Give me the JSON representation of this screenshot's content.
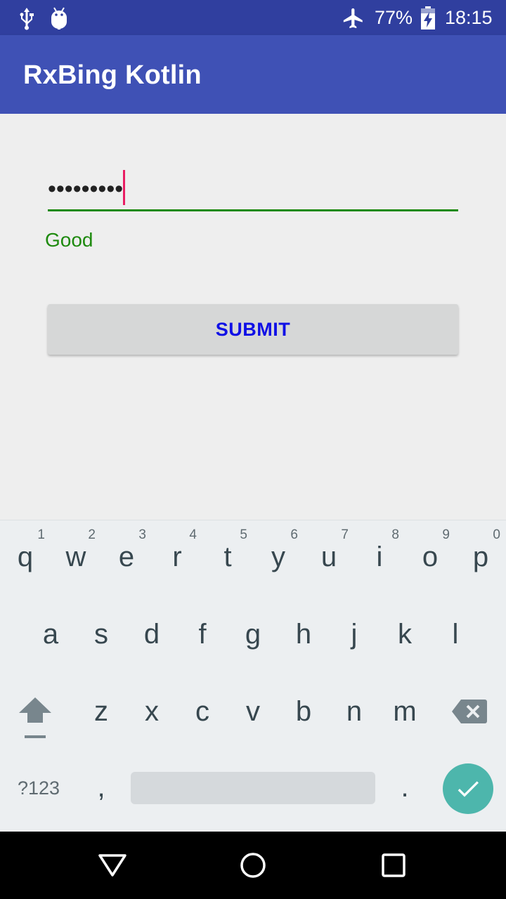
{
  "status_bar": {
    "battery_percent": "77%",
    "time": "18:15",
    "icons": [
      "usb-icon",
      "android-debug-icon",
      "airplane-mode-icon",
      "battery-charging-icon"
    ]
  },
  "app_bar": {
    "title": "RxBing Kotlin"
  },
  "password_field": {
    "value": "•••••••••"
  },
  "helper_text": "Good",
  "submit_button": {
    "label": "SUBMIT"
  },
  "keyboard": {
    "row1": [
      {
        "k": "q",
        "h": "1"
      },
      {
        "k": "w",
        "h": "2"
      },
      {
        "k": "e",
        "h": "3"
      },
      {
        "k": "r",
        "h": "4"
      },
      {
        "k": "t",
        "h": "5"
      },
      {
        "k": "y",
        "h": "6"
      },
      {
        "k": "u",
        "h": "7"
      },
      {
        "k": "i",
        "h": "8"
      },
      {
        "k": "o",
        "h": "9"
      },
      {
        "k": "p",
        "h": "0"
      }
    ],
    "row2": [
      "a",
      "s",
      "d",
      "f",
      "g",
      "h",
      "j",
      "k",
      "l"
    ],
    "row3": [
      "z",
      "x",
      "c",
      "v",
      "b",
      "n",
      "m"
    ],
    "symbols_label": "?123",
    "comma": ",",
    "period": "."
  },
  "colors": {
    "status_bar": "#303f9f",
    "app_bar": "#3f51b5",
    "valid_green": "#1e8a0e",
    "cursor_pink": "#e91e63",
    "button_text_blue": "#1010e6",
    "done_key_teal": "#4db6ac"
  }
}
